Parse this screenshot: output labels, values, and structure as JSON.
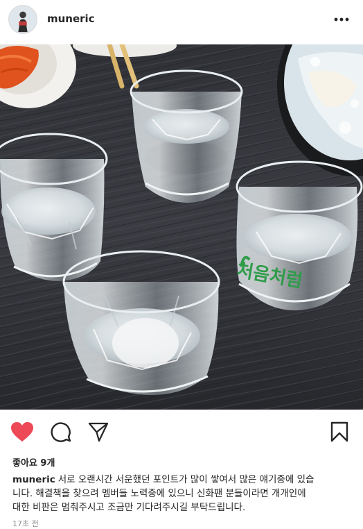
{
  "post": {
    "username": "muneric",
    "avatar_icon": "profile-avatar",
    "more_icon": "more-horizontal-icon",
    "likes_text": "좋아요 9개",
    "caption": {
      "username": "muneric",
      "line1": "서로 오랜시간 서운했던 포인트가 많이 쌓여서 많은 얘기중에 있습",
      "line2": "니다. 해결책을 찾으려 멤버들 노력중에 있으니 신화팬 분들이라면 개개인에",
      "line3": "대한 비판은 멈춰주시고 조금만 기다려주시길 부탁드립니다."
    },
    "time": "17초 전",
    "photo_label_text": "처음처럼"
  },
  "actions": {
    "like_icon": "heart-filled-icon",
    "like_color": "#ed4956",
    "comment_icon": "comment-icon",
    "share_icon": "send-icon",
    "save_icon": "bookmark-icon"
  }
}
